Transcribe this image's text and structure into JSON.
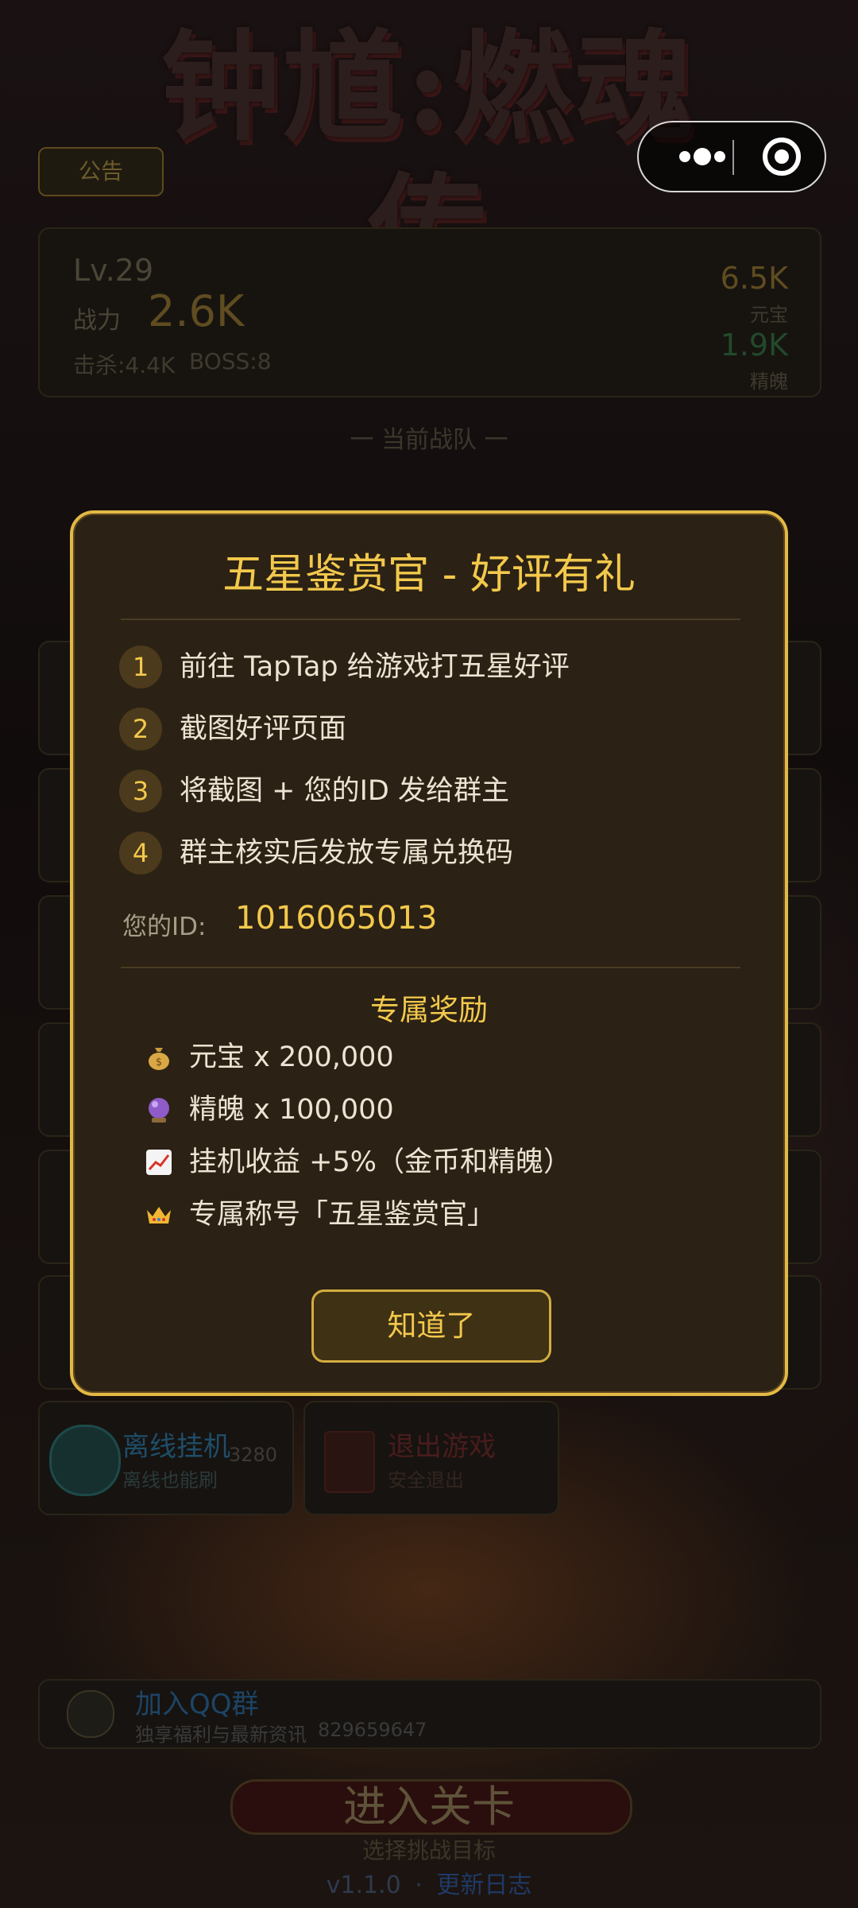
{
  "game_title": "钟馗:燃魂传",
  "header": {
    "notice_label": "公告"
  },
  "capsule": {
    "more_icon": "more-dots-icon",
    "close_icon": "target-close-icon"
  },
  "stats": {
    "level": "Lv.29",
    "power_label": "战力",
    "power_value": "2.6K",
    "kills": "击杀:4.4K",
    "boss": "BOSS:8",
    "yuanbao_value": "6.5K",
    "yuanbao_label": "元宝",
    "jingpo_value": "1.9K",
    "jingpo_label": "精魄"
  },
  "team_title": "一 当前战队 一",
  "menu": {
    "offline_title": "离线挂机",
    "offline_sub": "离线也能刷",
    "offline_count": "3280",
    "exit_title": "退出游戏",
    "exit_sub": "安全退出"
  },
  "qq": {
    "title": "加入QQ群",
    "sub": "独享福利与最新资讯",
    "group_id": "829659647"
  },
  "enter": {
    "label": "进入关卡",
    "sub": "选择挑战目标"
  },
  "footer": {
    "version": "v1.1.0",
    "sep": "·",
    "changelog": "更新日志"
  },
  "modal": {
    "title": "五星鉴赏官 - 好评有礼",
    "steps": [
      {
        "num": "1",
        "text": "前往 TapTap 给游戏打五星好评"
      },
      {
        "num": "2",
        "text": "截图好评页面"
      },
      {
        "num": "3",
        "text": "将截图 + 您的ID 发给群主"
      },
      {
        "num": "4",
        "text": "群主核实后发放专属兑换码"
      }
    ],
    "id_label": "您的ID:",
    "id_value": "1016065013",
    "reward_title": "专属奖励",
    "rewards": [
      {
        "icon": "money-bag-icon",
        "text": "元宝 x 200,000"
      },
      {
        "icon": "crystal-ball-icon",
        "text": "精魄 x 100,000"
      },
      {
        "icon": "chart-up-icon",
        "text": "挂机收益 +5%（金币和精魄）"
      },
      {
        "icon": "crown-icon",
        "text": "专属称号「五星鉴赏官」"
      }
    ],
    "ok_label": "知道了"
  }
}
